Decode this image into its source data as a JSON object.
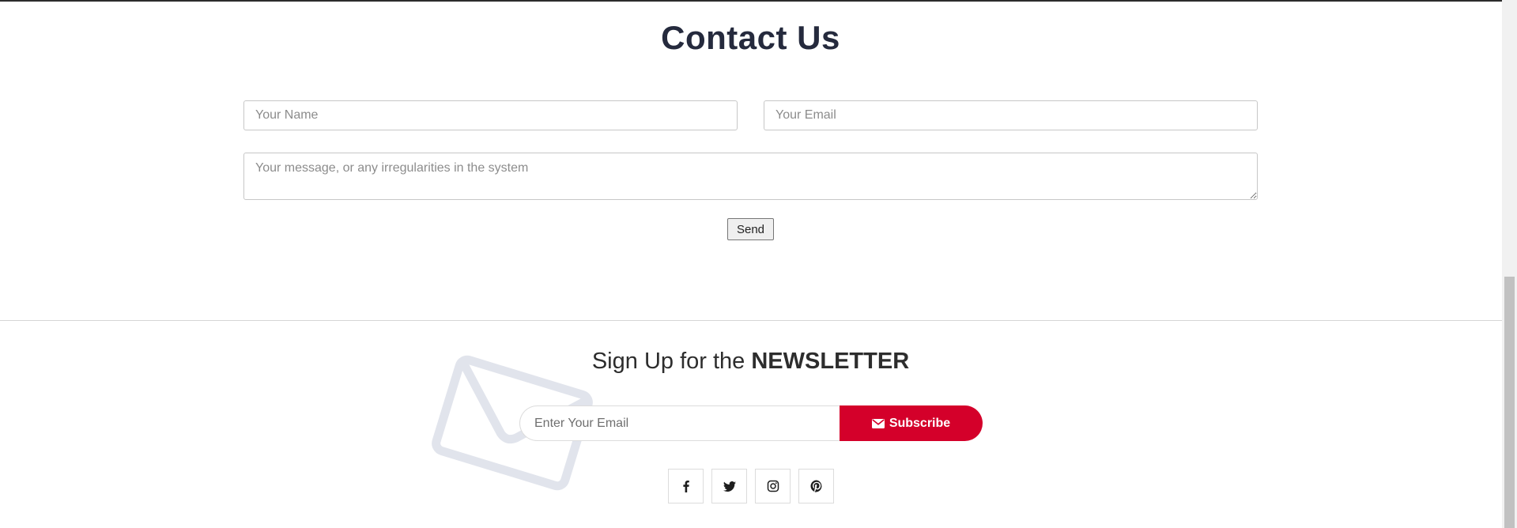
{
  "contact": {
    "title": "Contact Us",
    "name_placeholder": "Your Name",
    "email_placeholder": "Your Email",
    "message_placeholder": "Your message, or any irregularities in the system",
    "send_label": "Send"
  },
  "newsletter": {
    "title_prefix": "Sign Up for the",
    "title_bold": "NEWSLETTER",
    "email_placeholder": "Enter Your Email",
    "subscribe_label": "Subscribe",
    "accent_color": "#d4002a"
  },
  "social": [
    {
      "icon": "facebook-icon"
    },
    {
      "icon": "twitter-icon"
    },
    {
      "icon": "instagram-icon"
    },
    {
      "icon": "pinterest-icon"
    }
  ]
}
